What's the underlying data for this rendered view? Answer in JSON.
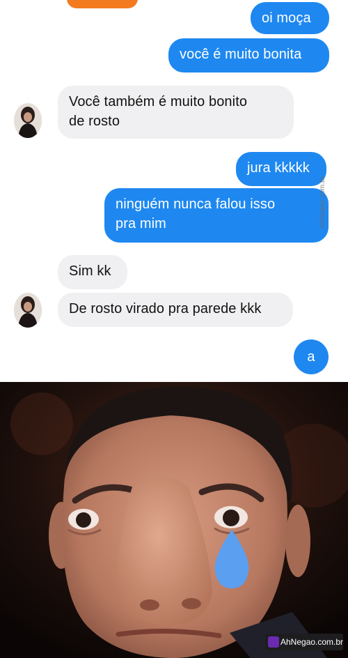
{
  "messages": [
    {
      "id": "m1",
      "direction": "sent",
      "text": "oi moça"
    },
    {
      "id": "m2",
      "direction": "sent",
      "text": "você é muito bonita"
    },
    {
      "id": "m3",
      "direction": "received",
      "lines": [
        "Você também é muito bonito",
        "de rosto"
      ]
    },
    {
      "id": "m4",
      "direction": "sent",
      "text": "jura kkkkk"
    },
    {
      "id": "m5",
      "direction": "sent",
      "lines": [
        "ninguém nunca falou isso",
        "pra mim"
      ]
    },
    {
      "id": "m6",
      "direction": "received",
      "text": "Sim kk"
    },
    {
      "id": "m7",
      "direction": "received",
      "text": "De rosto virado pra parede kkk"
    },
    {
      "id": "m8",
      "direction": "sent",
      "text": "a"
    }
  ],
  "watermark": {
    "side_text": "AhNegao.com.br",
    "footer_text": "AhNegao.com.br"
  },
  "colors": {
    "sent_bubble": "#1e88f0",
    "received_bubble": "#f0f0f2",
    "top_tab": "#f47a20",
    "tear": "#5b9ff0"
  }
}
